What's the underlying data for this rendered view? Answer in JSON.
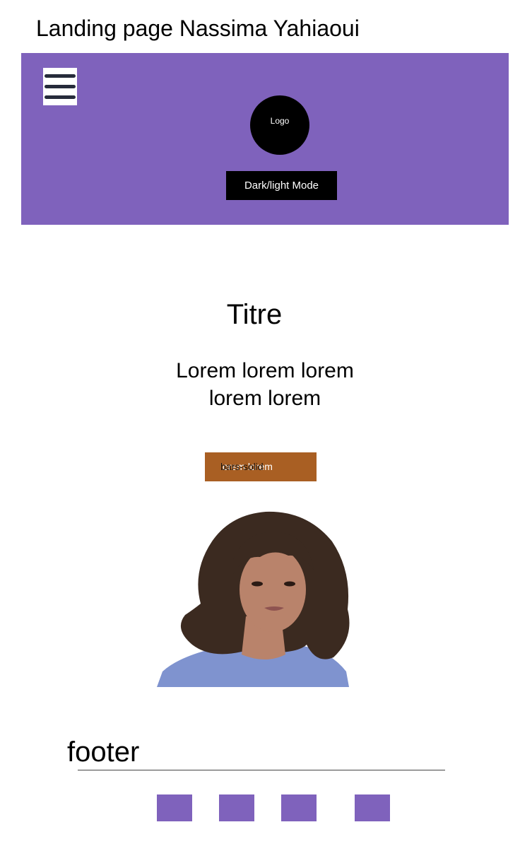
{
  "page": {
    "label": "Landing page Nassima Yahiaoui"
  },
  "header": {
    "background_color": "#7f62bc",
    "menu_icon_color": "#262b3b",
    "logo_label": "Logo",
    "mode_button_label": "Dark/light Mode"
  },
  "hero": {
    "title": "Titre",
    "subtitle_line1": "Lorem lorem lorem",
    "subtitle_line2": "lorem lorem",
    "cta": {
      "background_color": "#a95f23",
      "overlapping_texts": [
        "lorem lorem",
        "bars-solid"
      ]
    }
  },
  "portrait": {
    "hair_color": "#3b2a20",
    "skin_color": "#b9836b",
    "shirt_color": "#7f93cf"
  },
  "footer": {
    "title": "footer",
    "social_color": "#7f62bc",
    "social_icons": [
      "social-link-1",
      "social-link-2",
      "social-link-3",
      "social-link-4"
    ]
  }
}
